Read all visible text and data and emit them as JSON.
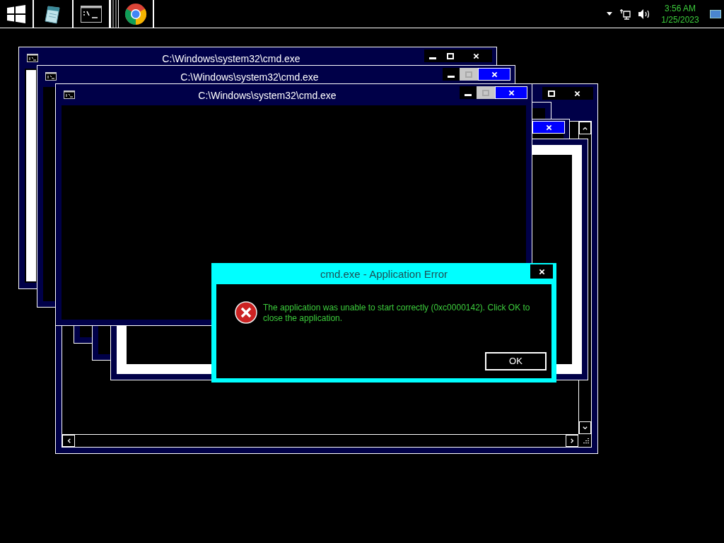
{
  "taskbar": {
    "apps": [
      {
        "kind": "start"
      },
      {
        "kind": "notepad"
      },
      {
        "kind": "console"
      },
      {
        "kind": "browser"
      }
    ],
    "tray": {
      "time": "3:56 AM",
      "date": "1/25/2023"
    }
  },
  "windows": [
    {
      "title": "C:\\Windows\\system32\\cmd.exe",
      "close_highlighted": false,
      "maximize_disabled": false
    },
    {
      "title": "C:\\Windows\\system32\\cmd.exe",
      "close_highlighted": true,
      "maximize_disabled": true
    },
    {
      "title": "C:\\Windows\\system32\\cmd.exe",
      "close_highlighted": true,
      "maximize_disabled": true
    }
  ],
  "dialog": {
    "title": "cmd.exe - Application Error",
    "message": "The application was unable to start correctly (0xc0000142). Click OK to close the application.",
    "button": "OK"
  }
}
